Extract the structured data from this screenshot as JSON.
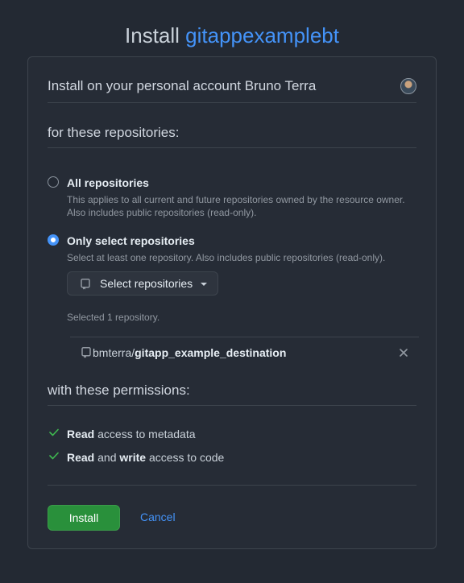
{
  "header": {
    "prefix": "Install",
    "app_name": "gitappexamplebt"
  },
  "account": {
    "label": "Install on your personal account Bruno Terra"
  },
  "repositories": {
    "heading": "for these repositories:",
    "options": [
      {
        "label": "All repositories",
        "description": "This applies to all current and future repositories owned by the resource owner. Also includes public repositories (read-only).",
        "checked": false
      },
      {
        "label": "Only select repositories",
        "description": "Select at least one repository. Also includes public repositories (read-only).",
        "checked": true
      }
    ],
    "select_button": "Select repositories",
    "selected_count": "Selected 1 repository.",
    "selected": [
      {
        "owner": "bmterra/",
        "name": "gitapp_example_destination"
      }
    ]
  },
  "permissions": {
    "heading": "with these permissions:",
    "items": [
      {
        "parts": [
          "Read",
          " access to metadata"
        ]
      },
      {
        "parts": [
          "Read",
          " and ",
          "write",
          " access to code"
        ]
      }
    ]
  },
  "actions": {
    "install": "Install",
    "cancel": "Cancel"
  },
  "colors": {
    "accent": "#4493f8",
    "install_button": "#29903b",
    "check": "#3fb950"
  },
  "icons": [
    "repo-icon",
    "check-icon",
    "close-icon",
    "avatar"
  ]
}
